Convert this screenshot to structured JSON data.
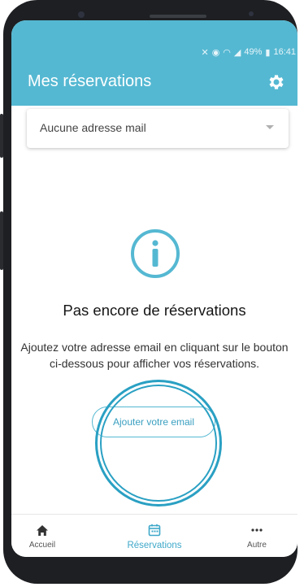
{
  "status_bar": {
    "battery": "49%",
    "time": "16:41"
  },
  "header": {
    "title": "Mes réservations",
    "settings_icon": "gear-icon"
  },
  "email_select": {
    "value": "Aucune adresse mail"
  },
  "empty_state": {
    "icon": "info-icon",
    "title": "Pas encore de réservations",
    "description": "Ajoutez votre adresse email en cliquant sur le bouton ci-dessous pour afficher vos réservations.",
    "button_label": "Ajouter votre email"
  },
  "bottom_nav": {
    "items": [
      {
        "label": "Accueil",
        "icon": "home-icon",
        "active": false
      },
      {
        "label": "Réservations",
        "icon": "calendar-icon",
        "active": true
      },
      {
        "label": "Autre",
        "icon": "more-icon",
        "active": false
      }
    ]
  },
  "colors": {
    "primary": "#55b8d2",
    "accent": "#3ea8c9",
    "highlight_ring": "#2aa0c3"
  }
}
